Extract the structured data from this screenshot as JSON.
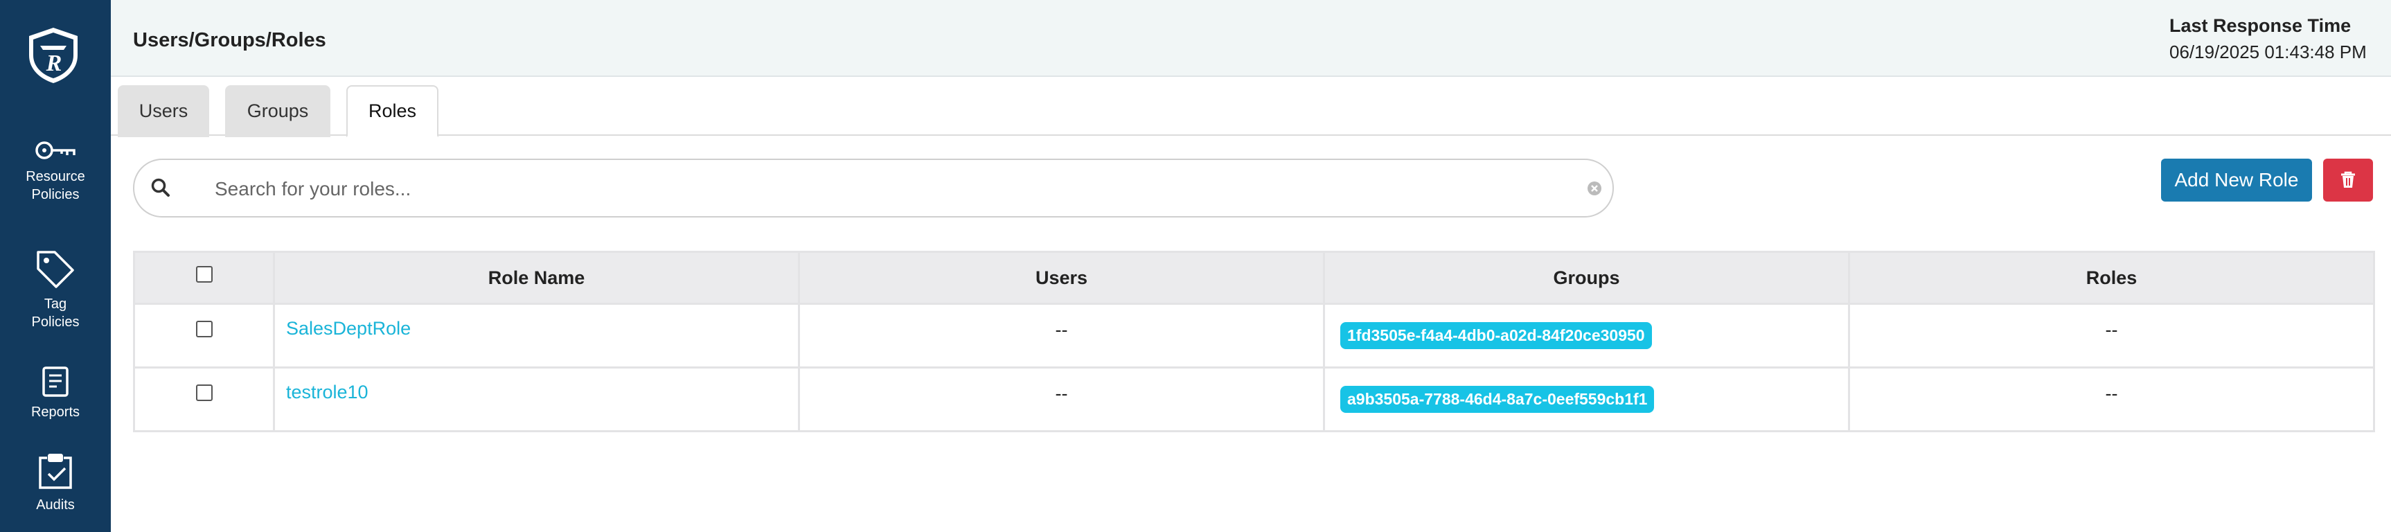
{
  "sidebar": {
    "items": [
      {
        "label": "Resource Policies",
        "icon": "key-icon"
      },
      {
        "label": "Tag Policies",
        "icon": "tag-icon"
      },
      {
        "label": "Reports",
        "icon": "report-icon"
      },
      {
        "label": "Audits",
        "icon": "clipboard-check-icon"
      }
    ]
  },
  "header": {
    "title": "Users/Groups/Roles",
    "response_label": "Last Response Time",
    "response_value": "06/19/2025 01:43:48 PM"
  },
  "tabs": [
    {
      "label": "Users",
      "active": false
    },
    {
      "label": "Groups",
      "active": false
    },
    {
      "label": "Roles",
      "active": true
    }
  ],
  "search": {
    "placeholder": "Search for your roles...",
    "value": ""
  },
  "actions": {
    "add_label": "Add New Role",
    "delete_icon": "trash-icon"
  },
  "table": {
    "columns": [
      "Role Name",
      "Users",
      "Groups",
      "Roles"
    ],
    "rows": [
      {
        "name": "SalesDeptRole",
        "users": "--",
        "groups": "1fd3505e-f4a4-4db0-a02d-84f20ce30950",
        "roles": "--"
      },
      {
        "name": "testrole10",
        "users": "--",
        "groups": "a9b3505a-7788-46d4-8a7c-0eef559cb1f1",
        "roles": "--"
      }
    ]
  },
  "colors": {
    "sidebar": "#123a5e",
    "primary": "#1a7bb0",
    "danger": "#dc3545",
    "badge": "#17c3e6",
    "link": "#1ab4d8"
  }
}
